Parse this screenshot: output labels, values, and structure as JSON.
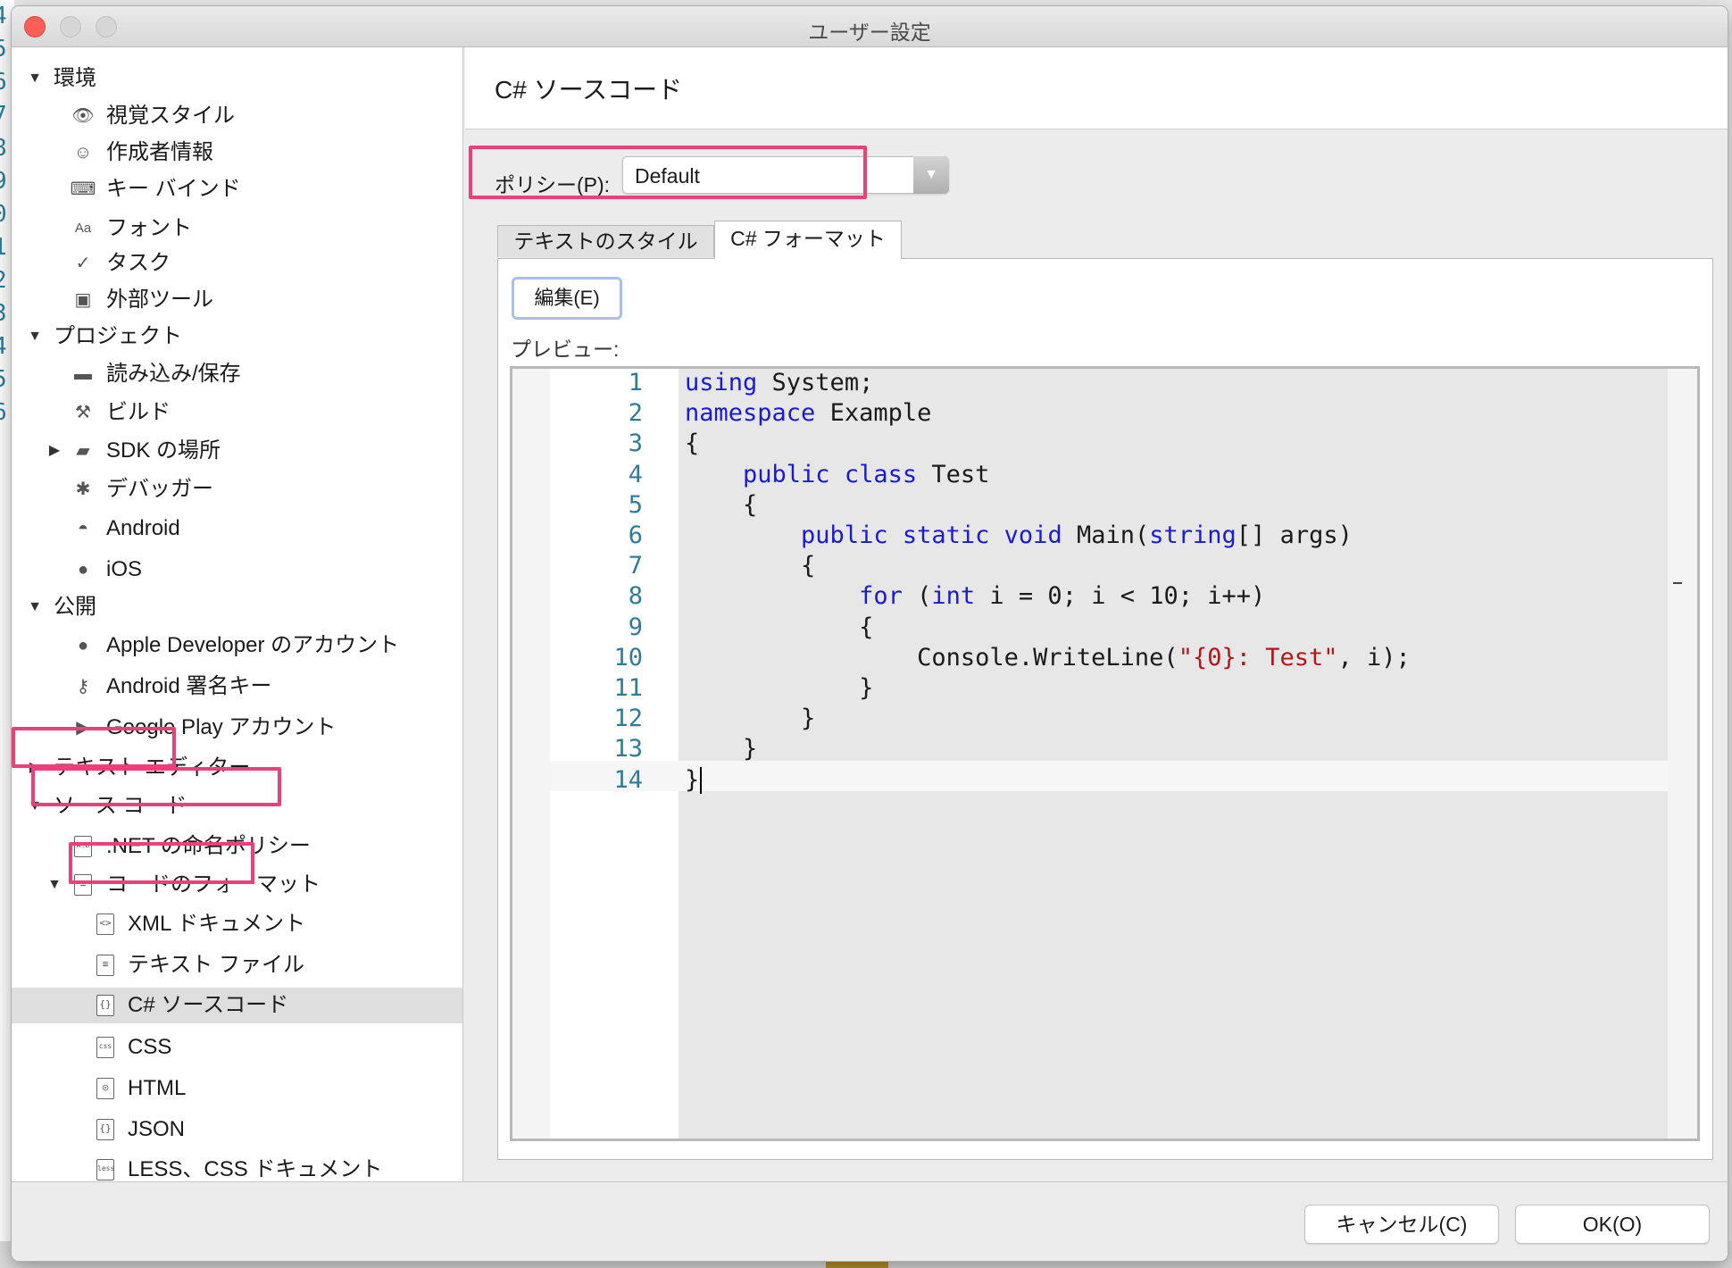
{
  "window": {
    "title": "ユーザー設定"
  },
  "background": {
    "gutter_numbers": [
      "4",
      "5",
      "6",
      "7",
      "8",
      "9",
      "0",
      "1",
      "2",
      "3",
      "4",
      "5",
      "6"
    ]
  },
  "sidebar": {
    "items": [
      {
        "label": "環境",
        "kind": "group",
        "expanded": true,
        "icon": ""
      },
      {
        "label": "視覚スタイル",
        "kind": "item",
        "icon": "eye-icon"
      },
      {
        "label": "作成者情報",
        "kind": "item",
        "icon": "smiley-icon"
      },
      {
        "label": "キー バインド",
        "kind": "item",
        "icon": "keybinding-icon"
      },
      {
        "label": "フォント",
        "kind": "item",
        "icon": "font-icon"
      },
      {
        "label": "タスク",
        "kind": "item",
        "icon": "checkmark-icon"
      },
      {
        "label": "外部ツール",
        "kind": "item",
        "icon": "terminal-icon"
      },
      {
        "label": "プロジェクト",
        "kind": "group",
        "expanded": true,
        "icon": ""
      },
      {
        "label": "読み込み/保存",
        "kind": "item",
        "icon": "disk-icon"
      },
      {
        "label": "ビルド",
        "kind": "item",
        "icon": "hammer-icon"
      },
      {
        "label": "SDK の場所",
        "kind": "item",
        "icon": "folder-icon"
      },
      {
        "label": "デバッガー",
        "kind": "item",
        "icon": "bug-icon"
      },
      {
        "label": "Android",
        "kind": "item",
        "icon": "android-icon"
      },
      {
        "label": "iOS",
        "kind": "item",
        "icon": "apple-icon"
      },
      {
        "label": "公開",
        "kind": "group",
        "expanded": true,
        "icon": ""
      },
      {
        "label": "Apple Developer のアカウント",
        "kind": "item",
        "icon": "apple-icon"
      },
      {
        "label": "Android 署名キー",
        "kind": "item",
        "icon": "key-icon"
      },
      {
        "label": "Google Play アカウント",
        "kind": "item",
        "icon": "google-play-icon"
      },
      {
        "label": "テキスト エディター",
        "kind": "group",
        "expanded": false,
        "icon": ""
      },
      {
        "label": "ソース コード",
        "kind": "group",
        "expanded": true,
        "icon": ""
      },
      {
        "label": ".NET の命名ポリシー",
        "kind": "item",
        "icon": "naming-policy-icon"
      },
      {
        "label": "コードのフォーマット",
        "kind": "item",
        "icon": "code-format-icon"
      },
      {
        "label": "XML ドキュメント",
        "kind": "item",
        "icon": "xml-file-icon"
      },
      {
        "label": "テキスト ファイル",
        "kind": "item",
        "icon": "text-file-icon"
      },
      {
        "label": "C# ソースコード",
        "kind": "item",
        "icon": "csharp-file-icon",
        "selected": true
      },
      {
        "label": "CSS",
        "kind": "item",
        "icon": "css-file-icon"
      },
      {
        "label": "HTML",
        "kind": "item",
        "icon": "html-file-icon"
      },
      {
        "label": "JSON",
        "kind": "item",
        "icon": "json-file-icon"
      },
      {
        "label": "LESS、CSS ドキュメント",
        "kind": "item",
        "icon": "less-file-icon"
      }
    ]
  },
  "main": {
    "title": "C# ソースコード",
    "policy": {
      "label": "ポリシー(P):",
      "value": "Default"
    },
    "tabs": [
      {
        "label": "テキストのスタイル",
        "active": false
      },
      {
        "label": "C# フォーマット",
        "active": true
      }
    ],
    "edit_button": "編集(E)",
    "preview_label": "プレビュー:",
    "code_lines": [
      [
        {
          "t": "using",
          "c": "kw"
        },
        {
          "t": " System;",
          "c": ""
        }
      ],
      [
        {
          "t": "namespace",
          "c": "kw"
        },
        {
          "t": " Example",
          "c": ""
        }
      ],
      [
        {
          "t": "{",
          "c": ""
        }
      ],
      [
        {
          "t": "    ",
          "c": ""
        },
        {
          "t": "public",
          "c": "kw"
        },
        {
          "t": " ",
          "c": ""
        },
        {
          "t": "class",
          "c": "kw"
        },
        {
          "t": " Test",
          "c": ""
        }
      ],
      [
        {
          "t": "    {",
          "c": ""
        }
      ],
      [
        {
          "t": "        ",
          "c": ""
        },
        {
          "t": "public",
          "c": "kw"
        },
        {
          "t": " ",
          "c": ""
        },
        {
          "t": "static",
          "c": "kw"
        },
        {
          "t": " ",
          "c": ""
        },
        {
          "t": "void",
          "c": "kw"
        },
        {
          "t": " Main(",
          "c": ""
        },
        {
          "t": "string",
          "c": "kw"
        },
        {
          "t": "[] args)",
          "c": ""
        }
      ],
      [
        {
          "t": "        {",
          "c": ""
        }
      ],
      [
        {
          "t": "            ",
          "c": ""
        },
        {
          "t": "for",
          "c": "kw"
        },
        {
          "t": " (",
          "c": ""
        },
        {
          "t": "int",
          "c": "kw"
        },
        {
          "t": " i = 0; i < 10; i++)",
          "c": ""
        }
      ],
      [
        {
          "t": "            {",
          "c": ""
        }
      ],
      [
        {
          "t": "                Console.WriteLine(",
          "c": ""
        },
        {
          "t": "\"{0}: Test\"",
          "c": "str"
        },
        {
          "t": ", i);",
          "c": ""
        }
      ],
      [
        {
          "t": "            }",
          "c": ""
        }
      ],
      [
        {
          "t": "        }",
          "c": ""
        }
      ],
      [
        {
          "t": "    }",
          "c": ""
        }
      ],
      [
        {
          "t": "}",
          "c": ""
        }
      ]
    ],
    "cursor_line": 14
  },
  "footer": {
    "cancel": "キャンセル(C)",
    "ok": "OK(O)"
  },
  "colors": {
    "highlight": "#ee3f7a",
    "keyword": "#1a1ad0",
    "string": "#b01818",
    "line_number": "#2e7c98"
  }
}
